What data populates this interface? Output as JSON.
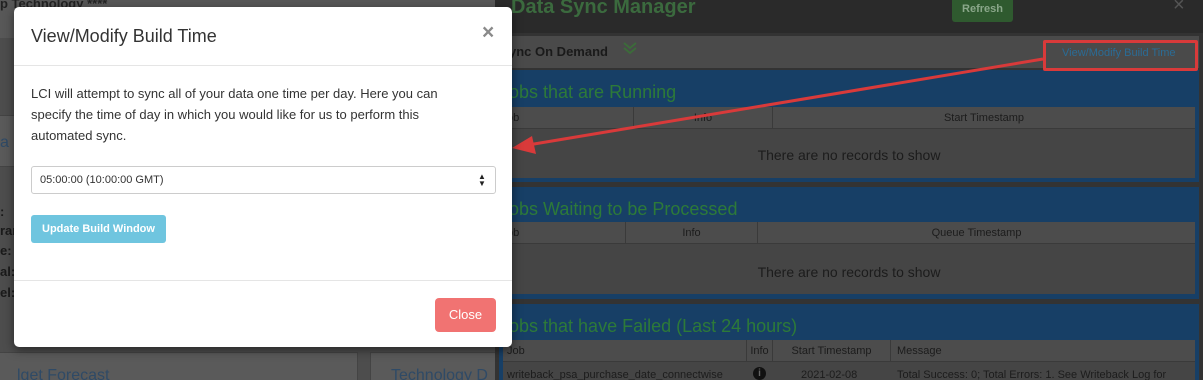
{
  "background": {
    "left_header_fragment": "op Technology ****",
    "left_card_fragments": [
      "a"
    ],
    "left_side_fragments": [
      ":",
      "ran",
      "e:",
      "al:",
      "el:"
    ],
    "bottom_cards": [
      "lget Forecast",
      "Technology D"
    ]
  },
  "app": {
    "title": "Data Sync Manager",
    "refresh_label": "Refresh",
    "close_glyph": "×",
    "sync_on_demand_label": "ync On Demand",
    "view_modify_link": "View/Modify Build Time",
    "panels": [
      {
        "title": "obs that are Running",
        "columns": [
          "ob",
          "Info",
          "Start Timestamp"
        ],
        "empty_text": "There are no records to show"
      },
      {
        "title": "obs Waiting to be Processed",
        "columns": [
          "ob",
          "Info",
          "Queue Timestamp"
        ],
        "empty_text": "There are no records to show"
      },
      {
        "title": "obs that have Failed (Last 24 hours)",
        "columns": [
          "Job",
          "Info",
          "Start Timestamp",
          "Message"
        ],
        "rows": [
          {
            "job": "writeback_psa_purchase_date_connectwise",
            "info_icon": "info-icon",
            "start": "2021-02-08",
            "message": "Total Success: 0; Total Errors: 1. See Writeback Log for"
          }
        ]
      }
    ]
  },
  "modal": {
    "title": "View/Modify Build Time",
    "close_glyph": "×",
    "description": "LCI will attempt to sync all of your data one time per day. Here you can specify the time of day in which you would like for us to perform this automated sync.",
    "select_value": "05:00:00 (10:00:00 GMT)",
    "update_button": "Update Build Window",
    "close_button": "Close"
  },
  "colors": {
    "annotation": "#d93a3a",
    "update_button": "#6fc5df",
    "close_button": "#f17372"
  }
}
